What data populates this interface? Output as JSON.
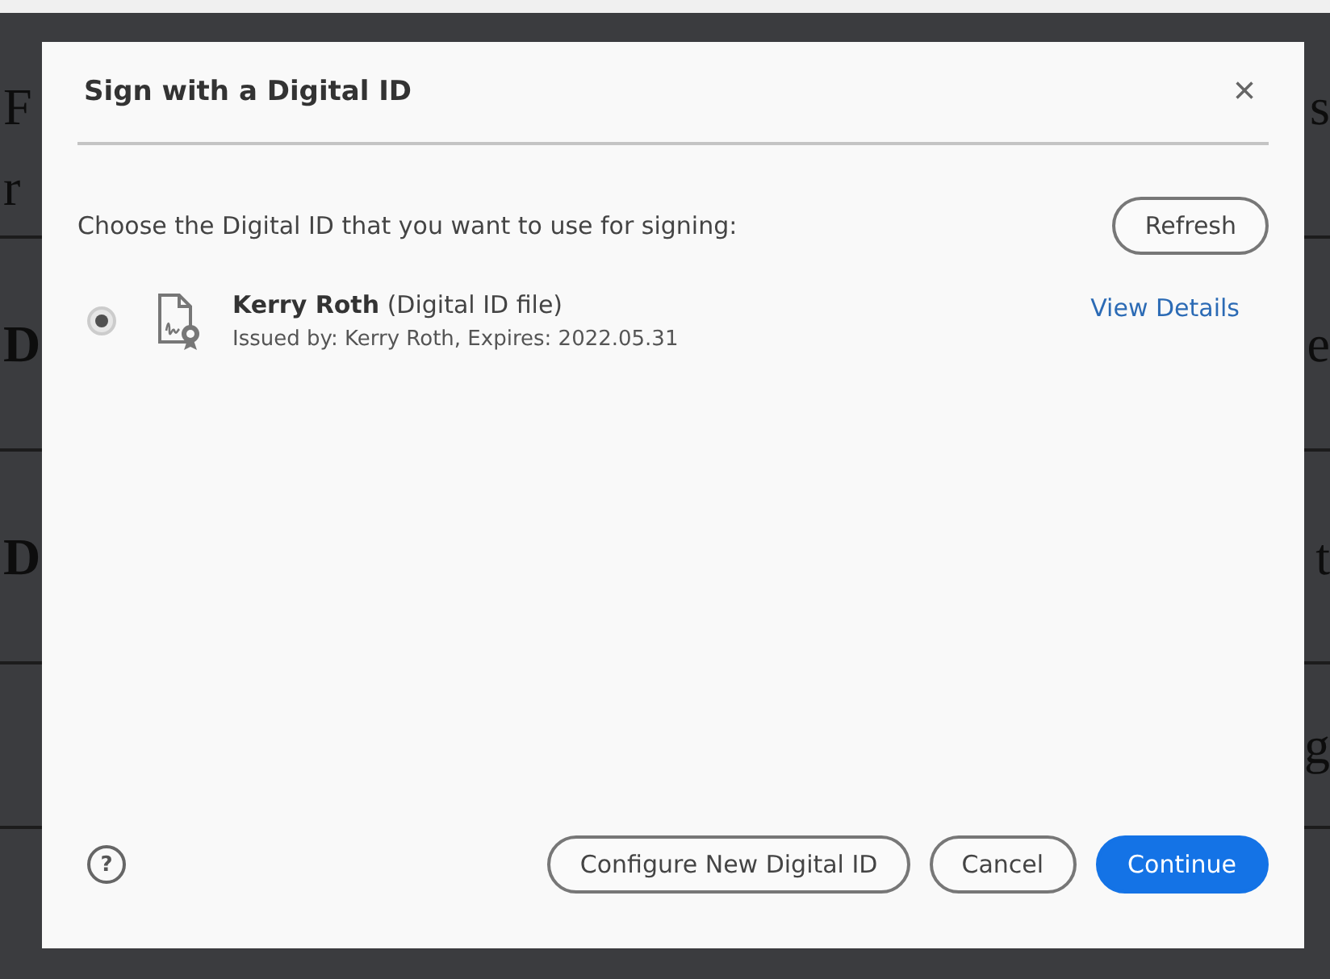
{
  "background_document": {
    "rows": [
      {},
      {
        "left": "F",
        "right": "s"
      },
      {
        "left": "r"
      },
      {
        "left": "D",
        "right": "e"
      },
      {
        "left": "D",
        "right": "t"
      },
      {
        "right": "g"
      },
      {}
    ]
  },
  "dialog": {
    "title": "Sign with a Digital ID",
    "close": "×",
    "prompt": "Choose the Digital ID that you want to use for signing:",
    "refresh_button": "Refresh",
    "ids": [
      {
        "name": "Kerry Roth",
        "type": "(Digital ID file)",
        "issued": "Issued by: Kerry Roth, Expires: 2022.05.31",
        "link": "View Details",
        "selected": true
      }
    ],
    "help": "?",
    "buttons": [
      {
        "label": "Configure New Digital ID",
        "kind": "secondary"
      },
      {
        "label": "Cancel",
        "kind": "secondary"
      },
      {
        "label": "Continue",
        "kind": "primary"
      }
    ]
  }
}
